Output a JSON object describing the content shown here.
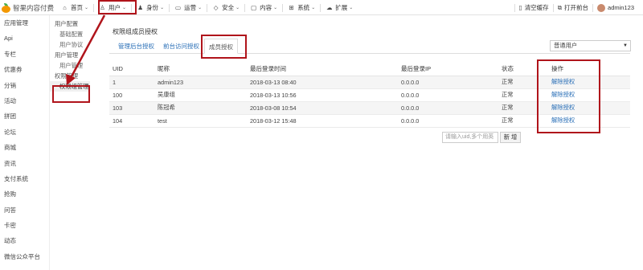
{
  "app": {
    "name": "智果内容付费"
  },
  "nav": [
    {
      "label": "首页",
      "icon": "home-icon",
      "glyph": "⌂"
    },
    {
      "label": "用户",
      "icon": "user-icon",
      "glyph": "♙"
    },
    {
      "label": "身份",
      "icon": "identity-icon",
      "glyph": "♟"
    },
    {
      "label": "运营",
      "icon": "monitor-icon",
      "glyph": "▭"
    },
    {
      "label": "安全",
      "icon": "shield-icon",
      "glyph": "◇"
    },
    {
      "label": "内容",
      "icon": "content-icon",
      "glyph": "▢"
    },
    {
      "label": "系统",
      "icon": "windows-icon",
      "glyph": "⊞"
    },
    {
      "label": "扩展",
      "icon": "cloud-icon",
      "glyph": "☁"
    }
  ],
  "top_right": {
    "clear_cache": "清空缓存",
    "open_front": "打开前台",
    "username": "admin123"
  },
  "sidebar": [
    "应用管理",
    "Api",
    "专栏",
    "优惠券",
    "分销",
    "活动",
    "拼团",
    "论坛",
    "商城",
    "资讯",
    "支付系统",
    "抢购",
    "问答",
    "卡密",
    "动态",
    "微信公众平台"
  ],
  "subnav": {
    "group1": "用户配置",
    "item1": "基础配置",
    "item2": "用户协议",
    "group2": "用户管理",
    "item3": "用户管理",
    "group3": "权限管理",
    "item4": "权限组管理"
  },
  "page": {
    "title": "权限组成员授权",
    "tabs": [
      "管理后台授权",
      "前台访问授权",
      "成员授权"
    ],
    "select_value": "普通用户"
  },
  "table": {
    "headers": [
      "UID",
      "昵称",
      "最后登录时间",
      "最后登录IP",
      "状态",
      "操作"
    ],
    "rows": [
      {
        "uid": "1",
        "nick": "admin123",
        "time": "2018-03-13 08:40",
        "ip": "0.0.0.0",
        "status": "正常",
        "action": "解除授权"
      },
      {
        "uid": "100",
        "nick": "吴康组",
        "time": "2018-03-13 10:56",
        "ip": "0.0.0.0",
        "status": "正常",
        "action": "解除授权"
      },
      {
        "uid": "103",
        "nick": "陈冠希",
        "time": "2018-03-08 10:54",
        "ip": "0.0.0.0",
        "status": "正常",
        "action": "解除授权"
      },
      {
        "uid": "104",
        "nick": "test",
        "time": "2018-03-12 15:48",
        "ip": "0.0.0.0",
        "status": "正常",
        "action": "解除授权"
      }
    ]
  },
  "add_member": {
    "placeholder": "请输入uid,多个用英",
    "button": "新 增"
  },
  "colors": {
    "annotation": "#b0141b",
    "link": "#2a6fb7"
  }
}
